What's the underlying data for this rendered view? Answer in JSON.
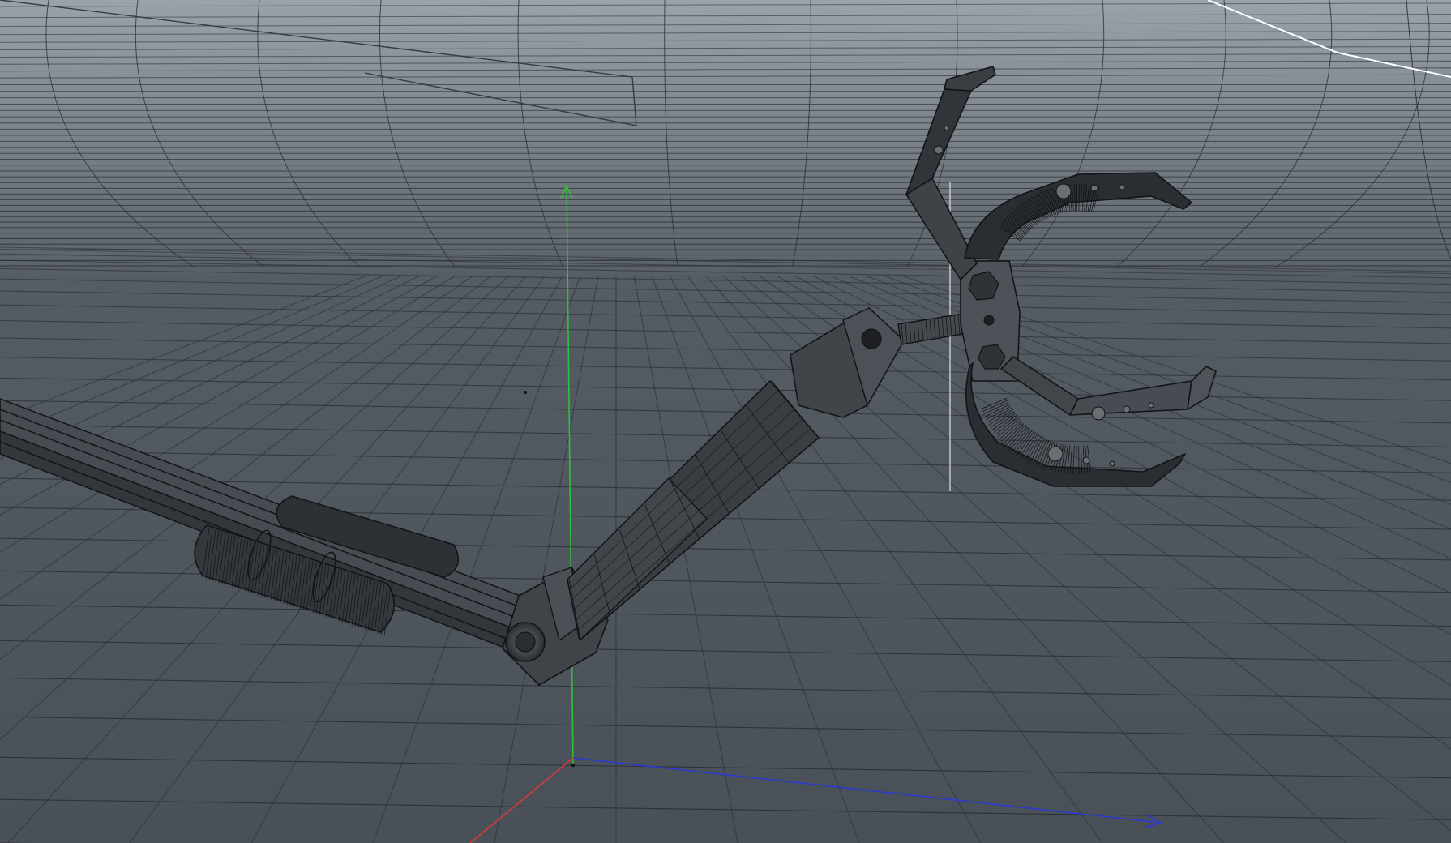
{
  "viewport": {
    "type": "3d-perspective-viewport",
    "display_mode": "shaded-wireframe",
    "colors": {
      "background_top": "#9aa2aa",
      "background_horizon": "#5d646b",
      "background_bottom": "#4a5058",
      "grid_line": "#2b2f34",
      "model_fill": "#3d4146",
      "model_dark": "#26292d",
      "model_edge": "#121416",
      "axis_y": "#2fbf3a",
      "axis_x": "#d83a3a",
      "axis_z": "#2a3ad0",
      "selection_line": "#ffffff"
    }
  },
  "scene": {
    "objects": [
      "cyclorama-backdrop",
      "floor-grid",
      "world-axis-gizmo",
      "robotic-arm"
    ],
    "axis_gizmo": {
      "axes": [
        "x-axis",
        "y-axis",
        "z-axis"
      ]
    },
    "robotic_arm": {
      "parts": [
        "upper-arm-rail",
        "hydraulic-cylinder",
        "elbow-joint",
        "forearm",
        "wrist-joint",
        "gripper-hub",
        "gripper-claw-upper-left",
        "gripper-claw-upper-right",
        "gripper-claw-lower-left",
        "gripper-claw-lower-right"
      ]
    }
  }
}
